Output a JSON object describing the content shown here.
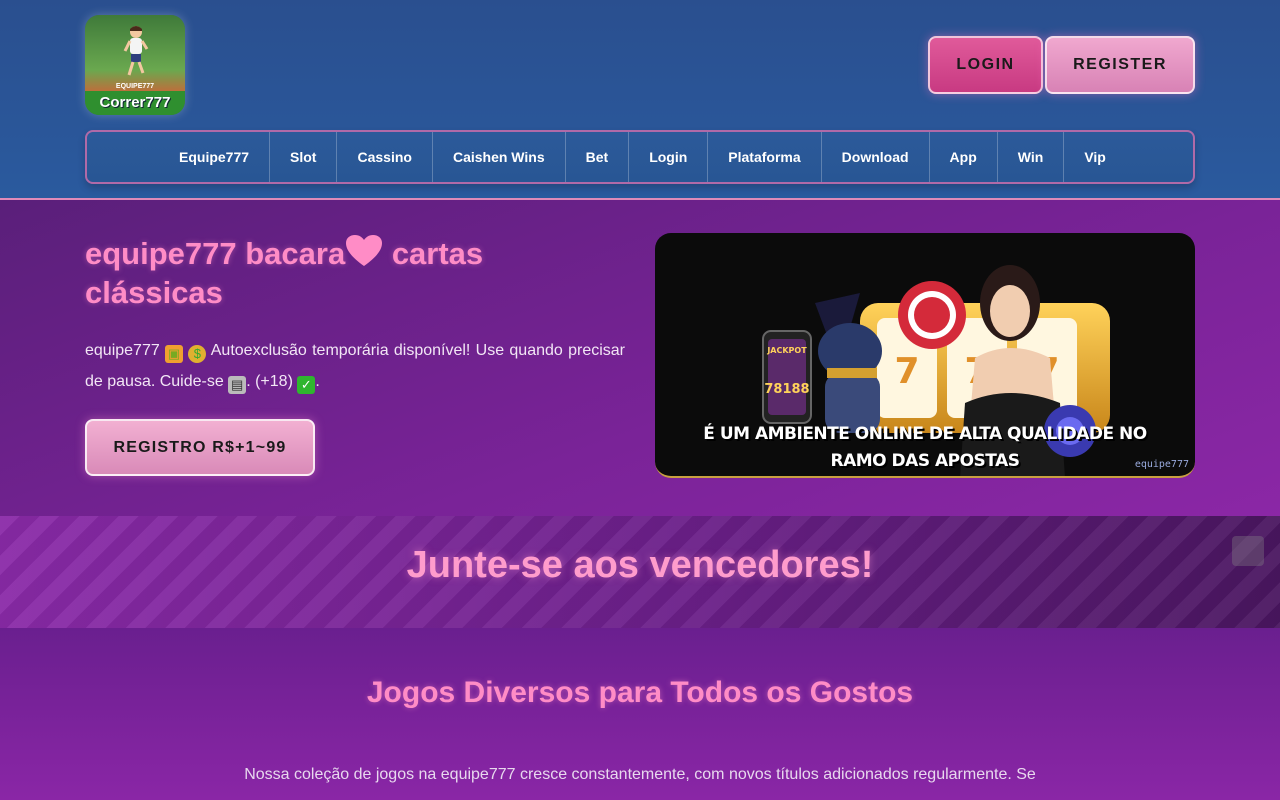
{
  "header": {
    "logo": {
      "text": "Correr777",
      "subtext": "EQUIPE777"
    },
    "login_label": "LOGIN",
    "register_label": "REGISTER"
  },
  "nav": {
    "items": [
      "Equipe777",
      "Slot",
      "Cassino",
      "Caishen Wins",
      "Bet",
      "Login",
      "Plataforma",
      "Download",
      "App",
      "Win",
      "Vip"
    ]
  },
  "hero": {
    "title_part1": "equipe777 bacara",
    "title_part2": " cartas clássicas",
    "text_part1": "equipe777 ",
    "text_part2": " Autoexclusão temporária disponível! Use quando precisar de pausa. Cuide-se ",
    "text_part3": ". (+18) ",
    "text_part4": ".",
    "button_label": "REGISTRO R$+1~99",
    "icons": [
      "heart-icon",
      "gift-icon",
      "money-bag-icon",
      "slot-machine-icon",
      "check-icon"
    ]
  },
  "banner": {
    "caption_line1": "É UM AMBIENTE ONLINE DE ALTA QUALIDADE NO",
    "caption_line2": "RAMO DAS APOSTAS",
    "watermark": "equipe777",
    "phone_text": "JACKPOT",
    "phone_number": "78188"
  },
  "strip": {
    "title": "Junte-se aos vencedores!"
  },
  "games": {
    "title": "Jogos Diversos para Todos os Gostos",
    "text": "Nossa coleção de jogos na equipe777 cresce constantemente, com novos títulos adicionados regularmente. Se"
  },
  "colors": {
    "header_bg": "#2a5a9e",
    "accent_pink": "#ff8cc6",
    "hero_bg": "#7a2398"
  }
}
